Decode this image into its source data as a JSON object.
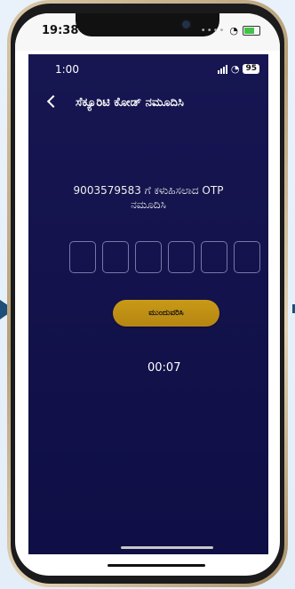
{
  "outer_status": {
    "time": "19:38"
  },
  "inner_status": {
    "time": "1:00",
    "battery": "95"
  },
  "header": {
    "title": "ಸೆಕ್ಯೂರಿಟಿ ಕೋಡ್ ನಮೂದಿಸಿ"
  },
  "otp": {
    "message": "9003579583 ಗೆ ಕಳುಹಿಸಲಾದ OTP ನಮೂದಿಸಿ",
    "boxes": [
      "",
      "",
      "",
      "",
      "",
      ""
    ]
  },
  "actions": {
    "continue_label": "ಮುಂದುವರಿಸಿ"
  },
  "timer": {
    "value": "00:07"
  },
  "colors": {
    "background": "#1A1960",
    "button": "#C99A17",
    "text": "#FFFFFF"
  }
}
